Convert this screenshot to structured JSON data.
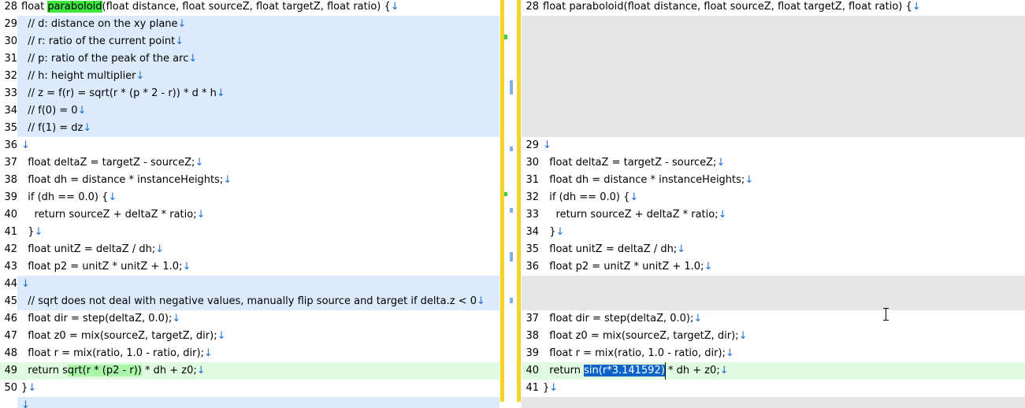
{
  "eol_glyph": "↓",
  "left": {
    "rows": [
      {
        "num": "28",
        "t": "",
        "code": "float paraboloid(float distance, float sourceZ, float targetZ, float ratio) {",
        "hl": "paraboloid"
      },
      {
        "num": "29",
        "t": "mod",
        "code": "  // d: distance on the xy plane"
      },
      {
        "num": "30",
        "t": "mod",
        "code": "  // r: ratio of the current point"
      },
      {
        "num": "31",
        "t": "mod",
        "code": "  // p: ratio of the peak of the arc"
      },
      {
        "num": "32",
        "t": "mod",
        "code": "  // h: height multiplier"
      },
      {
        "num": "33",
        "t": "mod",
        "code": "  // z = f(r) = sqrt(r * (p * 2 - r)) * d * h"
      },
      {
        "num": "34",
        "t": "mod",
        "code": "  // f(0) = 0"
      },
      {
        "num": "35",
        "t": "mod",
        "code": "  // f(1) = dz"
      },
      {
        "num": "36",
        "t": "",
        "code": ""
      },
      {
        "num": "37",
        "t": "",
        "code": "  float deltaZ = targetZ - sourceZ;"
      },
      {
        "num": "38",
        "t": "",
        "code": "  float dh = distance * instanceHeights;"
      },
      {
        "num": "39",
        "t": "",
        "code": "  if (dh == 0.0) {"
      },
      {
        "num": "40",
        "t": "",
        "code": "    return sourceZ + deltaZ * ratio;"
      },
      {
        "num": "41",
        "t": "",
        "code": "  }"
      },
      {
        "num": "42",
        "t": "",
        "code": "  float unitZ = deltaZ / dh;"
      },
      {
        "num": "43",
        "t": "",
        "code": "  float p2 = unitZ * unitZ + 1.0;"
      },
      {
        "num": "44",
        "t": "mod",
        "code": ""
      },
      {
        "num": "45",
        "t": "mod",
        "code": "  // sqrt does not deal with negative values, manually flip source and target if delta.z < 0"
      },
      {
        "num": "46",
        "t": "",
        "code": "  float dir = step(deltaZ, 0.0);"
      },
      {
        "num": "47",
        "t": "",
        "code": "  float z0 = mix(sourceZ, targetZ, dir);"
      },
      {
        "num": "48",
        "t": "",
        "code": "  float r = mix(ratio, 1.0 - ratio, dir);"
      },
      {
        "num": "49",
        "t": "add",
        "code": "  return sqrt(r * (p2 - r)) * dh + z0;",
        "hl2": "qrt(r * (p2 - r))"
      },
      {
        "num": "50",
        "t": "",
        "code": "}"
      },
      {
        "num": "",
        "t": "mod",
        "code": ""
      }
    ]
  },
  "right": {
    "rows": [
      {
        "num": "28",
        "t": "",
        "code": "float paraboloid(float distance, float sourceZ, float targetZ, float ratio) {"
      },
      {
        "num": "",
        "t": "pad",
        "code": ""
      },
      {
        "num": "",
        "t": "pad",
        "code": ""
      },
      {
        "num": "",
        "t": "pad",
        "code": ""
      },
      {
        "num": "",
        "t": "pad",
        "code": ""
      },
      {
        "num": "",
        "t": "pad",
        "code": ""
      },
      {
        "num": "",
        "t": "pad",
        "code": ""
      },
      {
        "num": "",
        "t": "pad",
        "code": ""
      },
      {
        "num": "29",
        "t": "",
        "code": ""
      },
      {
        "num": "30",
        "t": "",
        "code": "  float deltaZ = targetZ - sourceZ;"
      },
      {
        "num": "31",
        "t": "",
        "code": "  float dh = distance * instanceHeights;"
      },
      {
        "num": "32",
        "t": "",
        "code": "  if (dh == 0.0) {"
      },
      {
        "num": "33",
        "t": "",
        "code": "    return sourceZ + deltaZ * ratio;"
      },
      {
        "num": "34",
        "t": "",
        "code": "  }"
      },
      {
        "num": "35",
        "t": "",
        "code": "  float unitZ = deltaZ / dh;"
      },
      {
        "num": "36",
        "t": "",
        "code": "  float p2 = unitZ * unitZ + 1.0;"
      },
      {
        "num": "",
        "t": "pad",
        "code": ""
      },
      {
        "num": "",
        "t": "pad",
        "code": ""
      },
      {
        "num": "37",
        "t": "",
        "code": "  float dir = step(deltaZ, 0.0);"
      },
      {
        "num": "38",
        "t": "",
        "code": "  float z0 = mix(sourceZ, targetZ, dir);"
      },
      {
        "num": "39",
        "t": "",
        "code": "  float r = mix(ratio, 1.0 - ratio, dir);"
      },
      {
        "num": "40",
        "t": "add",
        "code": "  return sin(r*3.141592) * dh + z0;",
        "sel": "sin(r*3.141592)"
      },
      {
        "num": "41",
        "t": "",
        "code": "}"
      },
      {
        "num": "",
        "t": "pad",
        "code": ""
      }
    ]
  },
  "colors": {
    "modified": "#dcebfb",
    "added": "#e0fbe0",
    "padding": "#e6e6e6",
    "selection": "#0a63c9",
    "separator": "#f7d325"
  }
}
